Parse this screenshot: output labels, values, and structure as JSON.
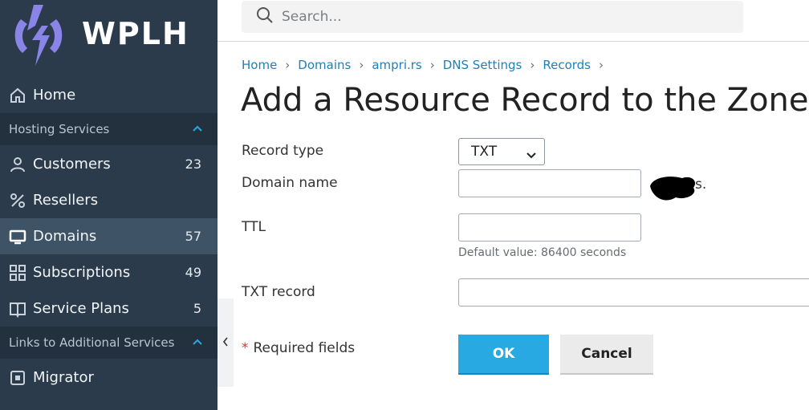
{
  "brand": {
    "name": "WPLH",
    "accent": "#8a84e8"
  },
  "search": {
    "placeholder": "Search..."
  },
  "sidebar": {
    "home": {
      "label": "Home",
      "icon": "home-icon"
    },
    "hosting_section": {
      "label": "Hosting Services"
    },
    "items": [
      {
        "label": "Customers",
        "count": "23",
        "icon": "user-icon"
      },
      {
        "label": "Resellers",
        "count": "",
        "icon": "percent-icon"
      },
      {
        "label": "Domains",
        "count": "57",
        "icon": "monitor-icon"
      },
      {
        "label": "Subscriptions",
        "count": "49",
        "icon": "grid-icon"
      },
      {
        "label": "Service Plans",
        "count": "5",
        "icon": "book-icon"
      }
    ],
    "links_section": {
      "label": "Links to Additional Services"
    },
    "migrator": {
      "label": "Migrator",
      "icon": "migrator-icon"
    }
  },
  "breadcrumb": [
    "Home",
    "Domains",
    "ampri.rs",
    "DNS Settings",
    "Records"
  ],
  "page": {
    "title": "Add a Resource Record to the Zone"
  },
  "form": {
    "record_type_label": "Record type",
    "record_type_value": "TXT",
    "domain_name_label": "Domain name",
    "domain_name_value": "",
    "domain_suffix": "s.",
    "ttl_label": "TTL",
    "ttl_value": "",
    "ttl_hint": "Default value: 86400 seconds",
    "txt_record_label": "TXT record",
    "txt_record_value": "",
    "required_star": "*",
    "required_label": "Required fields",
    "ok_label": "OK",
    "cancel_label": "Cancel"
  }
}
